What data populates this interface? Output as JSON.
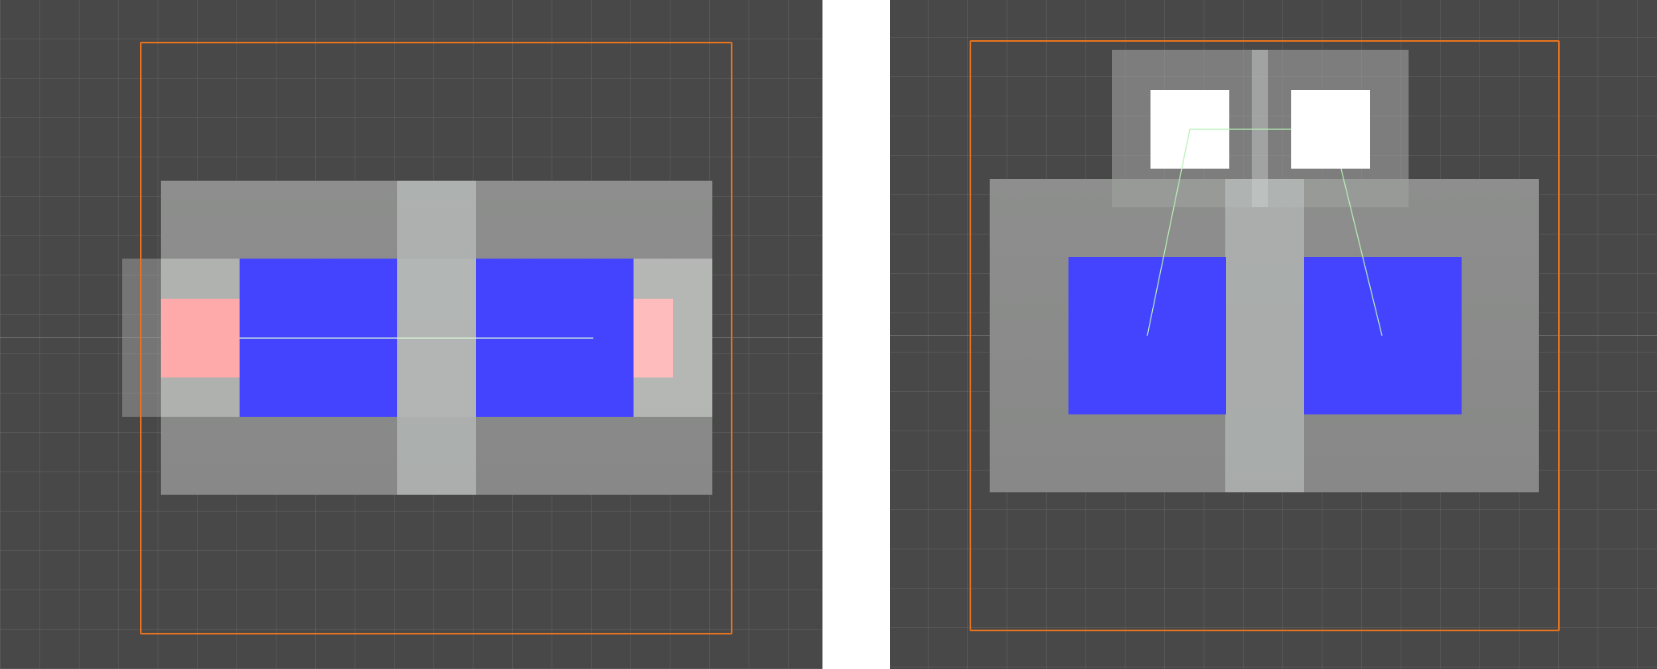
{
  "viewports": [
    {
      "id": "left",
      "background": "#484848",
      "frame_color": "#e6731f",
      "link_line_color": "#b8f0b8"
    },
    {
      "id": "right",
      "background": "#484848",
      "frame_color": "#e6731f",
      "link_line_color": "#b8f0b8"
    }
  ],
  "colors": {
    "blue_fill": "#4444ff",
    "pink_fill": "#ffaaaa",
    "white_fill": "#ffffff",
    "grey_block": "#8b8c8b",
    "separator": "#ffffff"
  }
}
